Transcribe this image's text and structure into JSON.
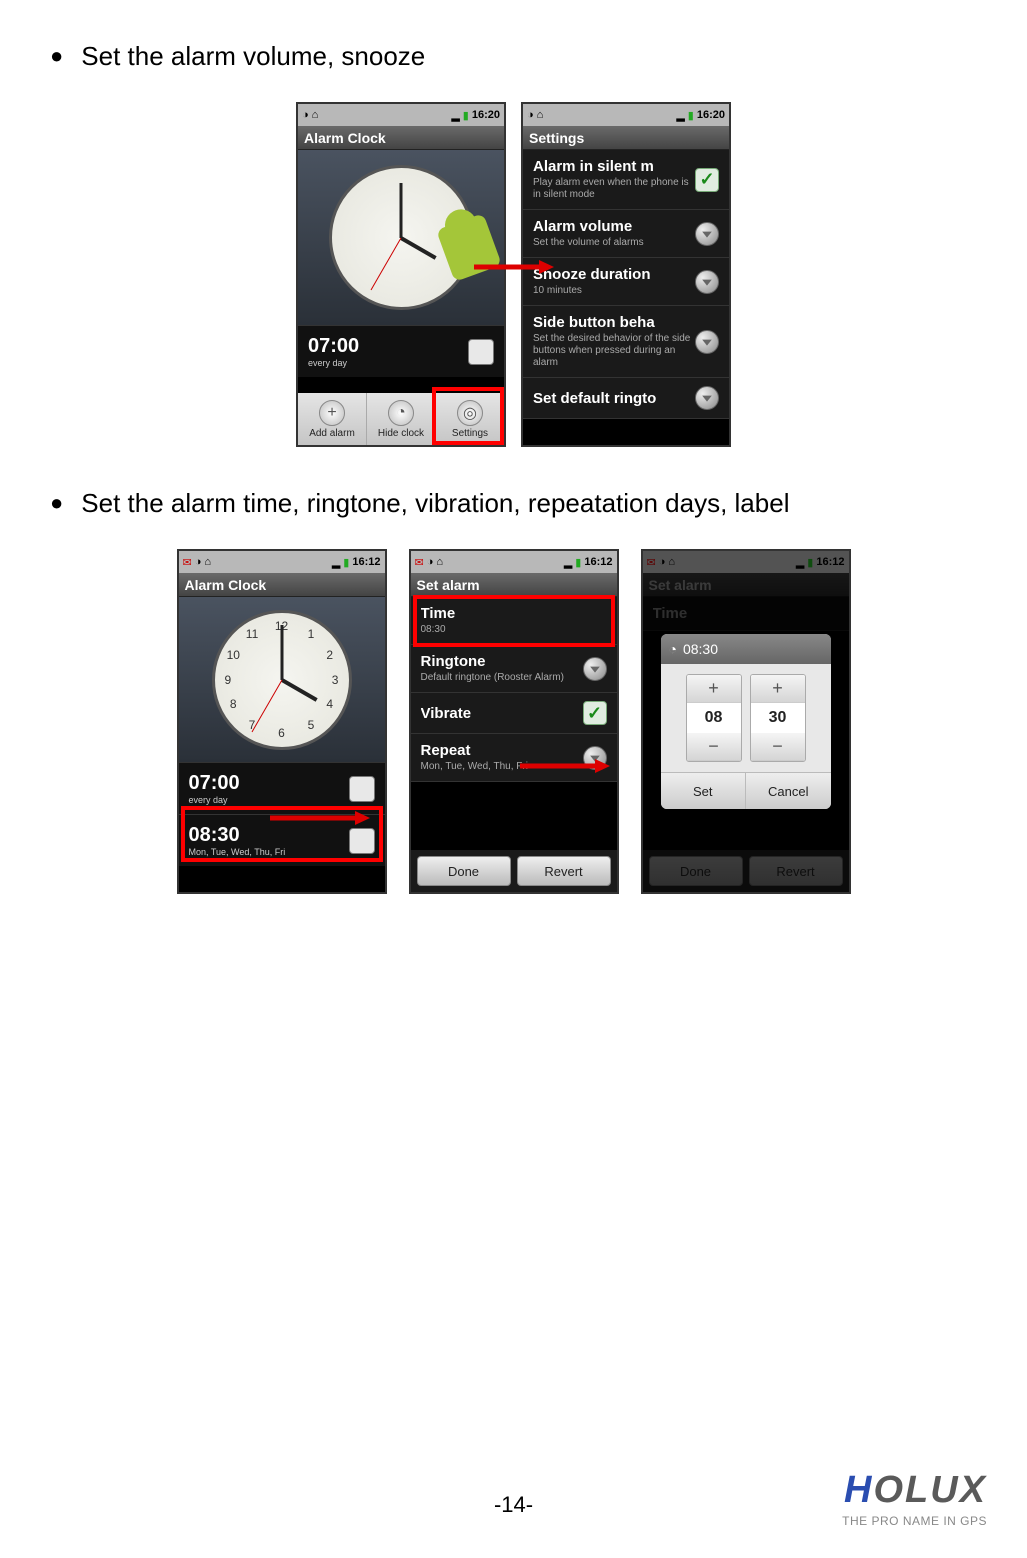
{
  "bullets": {
    "b1": "Set the alarm volume, snooze",
    "b2": "Set the alarm time, ringtone, vibration, repeatation days, label"
  },
  "status": {
    "time1": "16:20",
    "time2": "16:12"
  },
  "row1": {
    "left": {
      "title": "Alarm Clock",
      "alarm_time": "07:00",
      "alarm_sub": "every day",
      "btn_add": "Add alarm",
      "btn_hide": "Hide clock",
      "btn_settings": "Settings"
    },
    "right": {
      "title": "Settings",
      "i1_title": "Alarm in silent m",
      "i1_sub": "Play alarm even when the phone is in silent mode",
      "i2_title": "Alarm volume",
      "i2_sub": "Set the volume of alarms",
      "i3_title": "Snooze duration",
      "i3_sub": "10 minutes",
      "i4_title": "Side button beha",
      "i4_sub": "Set the desired behavior of the side buttons when pressed during an alarm",
      "i5_title": "Set default ringto"
    }
  },
  "row2": {
    "s1": {
      "title": "Alarm Clock",
      "a1_time": "07:00",
      "a1_sub": "every day",
      "a2_time": "08:30",
      "a2_sub": "Mon, Tue, Wed, Thu, Fri"
    },
    "s2": {
      "title": "Set alarm",
      "time_title": "Time",
      "time_val": "08:30",
      "ring_title": "Ringtone",
      "ring_val": "Default ringtone (Rooster Alarm)",
      "vib_title": "Vibrate",
      "rep_title": "Repeat",
      "rep_val": "Mon, Tue, Wed, Thu, Fri",
      "done": "Done",
      "revert": "Revert"
    },
    "s3": {
      "title": "Set alarm",
      "time_title": "Time",
      "dialog_time": "08:30",
      "hh": "08",
      "mm": "30",
      "set": "Set",
      "cancel": "Cancel",
      "done": "Done",
      "revert": "Revert"
    }
  },
  "clock_nums": [
    "12",
    "1",
    "2",
    "3",
    "4",
    "5",
    "6",
    "7",
    "8",
    "9",
    "10",
    "11"
  ],
  "page_num": "-14-",
  "logo": {
    "brand": "HOLUX",
    "tagline": "THE PRO NAME IN GPS"
  }
}
